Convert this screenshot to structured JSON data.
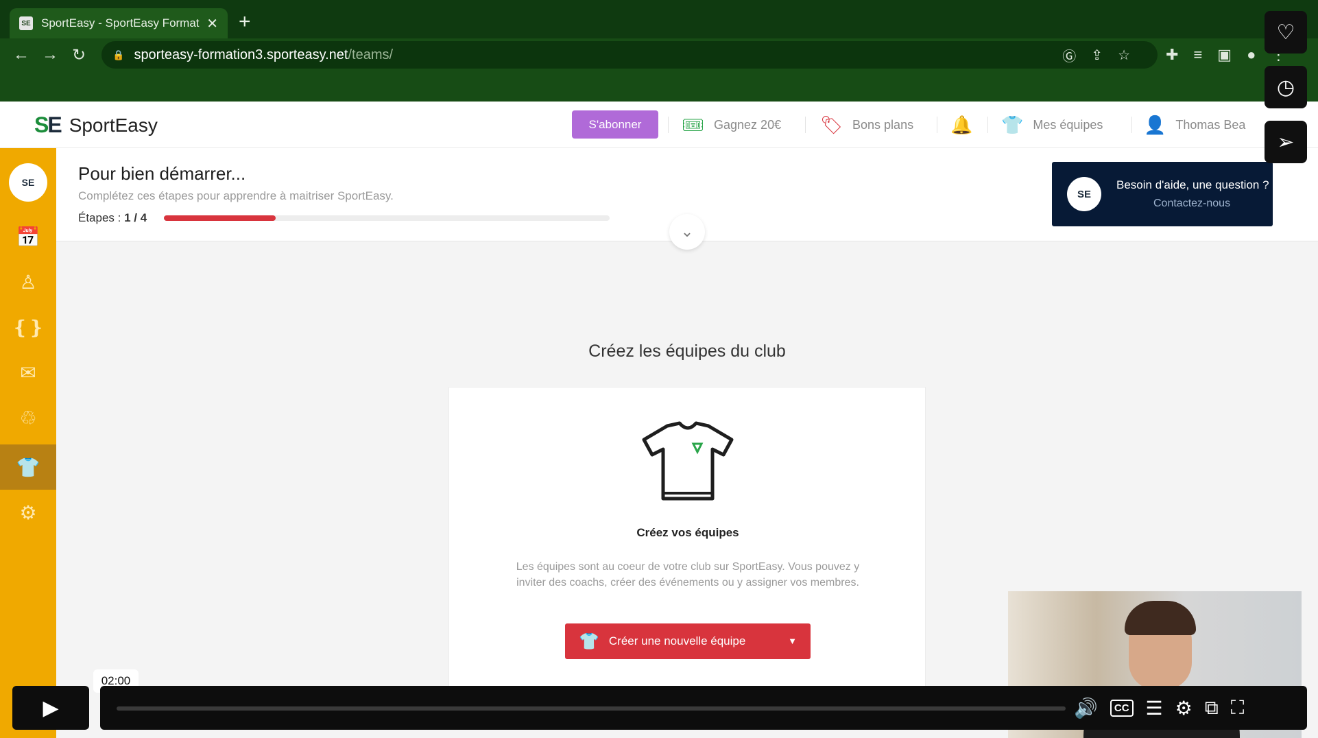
{
  "browser": {
    "tab_title": "SportEasy - SportEasy Format",
    "tab_close": "✕",
    "new_tab": "+",
    "url_host": "sporteasy-formation3.sporteasy.net",
    "url_path": "/teams/"
  },
  "header": {
    "brand": "SportEasy",
    "subscribe_label": "S'abonner",
    "earn_label": "Gagnez 20€",
    "deals_label": "Bons plans",
    "my_teams_label": "Mes équipes",
    "user_name": "Thomas Bea"
  },
  "sidebar": {
    "avatar_text": "SE",
    "items": [
      "calendar",
      "members",
      "groups",
      "messages",
      "donations",
      "teams",
      "settings"
    ],
    "active_item": "teams"
  },
  "onboarding": {
    "title": "Pour bien démarrer...",
    "subtitle": "Complétez ces étapes pour apprendre à maitriser SportEasy.",
    "steps_label": "Étapes : ",
    "steps_value": "1 / 4",
    "progress": 0.25
  },
  "help": {
    "avatar_text": "SE",
    "question": "Besoin d'aide, une question ?",
    "contact": "Contactez-nous"
  },
  "main": {
    "heading": "Créez les équipes du club",
    "card_title": "Créez vos équipes",
    "card_desc": "Les équipes sont au coeur de votre club sur SportEasy. Vous pouvez y inviter des coachs, créer des événements ou y assigner vos membres.",
    "create_button": "Créer une nouvelle équipe"
  },
  "player": {
    "time_tooltip": "02:00"
  },
  "colors": {
    "sidebar": "#f0a900",
    "accent_red": "#d8343d",
    "subscribe_purple": "#b06ad8",
    "help_navy": "#071a36"
  }
}
